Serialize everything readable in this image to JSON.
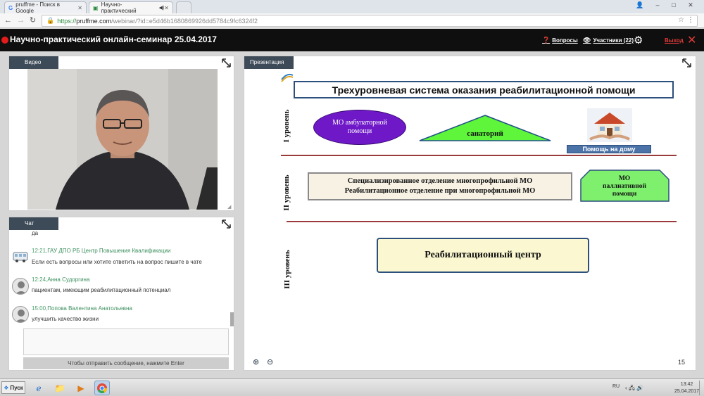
{
  "browser": {
    "tabs": [
      {
        "label": "pruffme - Поиск в Google",
        "icon": "google-icon"
      },
      {
        "label": "Научно-практический",
        "icon": "webinar-icon",
        "audio": true
      }
    ],
    "url": {
      "scheme": "https://",
      "host": "pruffme.com",
      "path": "/webinar/?id=e5d46b1680869926dd5784c9fc6324f2"
    }
  },
  "header": {
    "title": "Научно-практический онлайн-семинар 25.04.2017",
    "questions_label": "Вопросы",
    "participants_label": "Участники (22)",
    "exit_label": "Выход",
    "accent": "#e21b1b"
  },
  "video": {
    "tab_label": "Видео"
  },
  "presentation": {
    "tab_label": "Презентация",
    "page_number": "15",
    "slide": {
      "title": "Трехуровневая система оказания реабилитационной помощи",
      "level1": "I уровень",
      "level2": "II уровень",
      "level3": "III уровень",
      "mo_ambulatory": "МО амбулаторной помощи",
      "sanatorium": "санаторий",
      "home_help": "Помощь на дому",
      "specialized_line1": "Специализированное отделение многопрофильной МО",
      "specialized_line2": "Реабилитационное отделение при многопрофильной МО",
      "palliative": "МО паллиативной помощи",
      "rehab_center": "Реабилитационный центр"
    }
  },
  "chat": {
    "tab_label": "Чат",
    "messages": [
      {
        "author": "",
        "time": "",
        "text": "да"
      },
      {
        "author": "ГАУ ДПО РБ Центр Повышения Квалификации",
        "time": "12:21,",
        "text": "Если есть вопросы или хотите ответить на вопрос пишите в чате"
      },
      {
        "author": "Анна Судоргина",
        "time": "12:24,",
        "text": "пациентам, имеющим реабилитационный потенциал"
      },
      {
        "author": "Попова Валентина Анатольевна",
        "time": "15:00,",
        "text": "улучшить качество жизни"
      }
    ],
    "send_hint": "Чтобы отправить сообщение, нажмите Enter"
  },
  "taskbar": {
    "start_label": "Пуск",
    "lang": "RU",
    "time": "13:42",
    "date": "25.04.2017"
  }
}
